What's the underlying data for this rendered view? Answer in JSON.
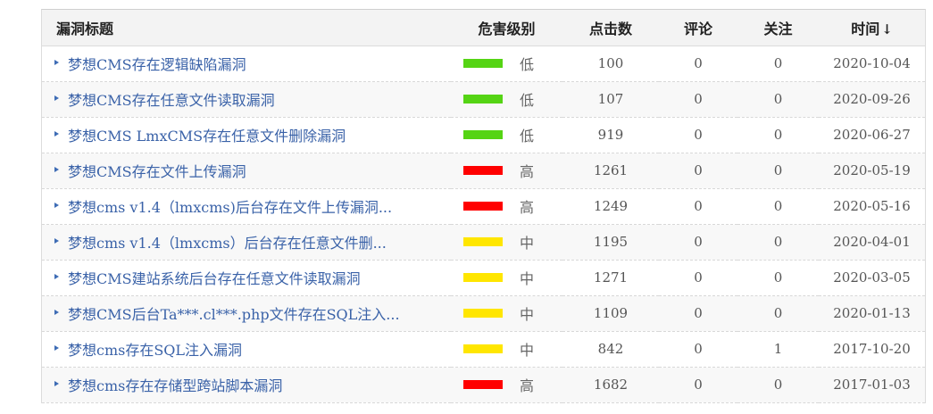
{
  "columns": {
    "title": "漏洞标题",
    "severity": "危害级别",
    "clicks": "点击数",
    "comments": "评论",
    "follows": "关注",
    "time": "时间",
    "time_sort": "↓"
  },
  "colors": {
    "low": "#55d414",
    "high": "#ff0000",
    "medium": "#ffe600"
  },
  "rows": [
    {
      "title": "梦想CMS存在逻辑缺陷漏洞",
      "level": "low",
      "severity": "低",
      "clicks": "100",
      "comments": "0",
      "follows": "0",
      "time": "2020-10-04"
    },
    {
      "title": "梦想CMS存在任意文件读取漏洞",
      "level": "low",
      "severity": "低",
      "clicks": "107",
      "comments": "0",
      "follows": "0",
      "time": "2020-09-26"
    },
    {
      "title": "梦想CMS LmxCMS存在任意文件删除漏洞",
      "level": "low",
      "severity": "低",
      "clicks": "919",
      "comments": "0",
      "follows": "0",
      "time": "2020-06-27"
    },
    {
      "title": "梦想CMS存在文件上传漏洞",
      "level": "high",
      "severity": "高",
      "clicks": "1261",
      "comments": "0",
      "follows": "0",
      "time": "2020-05-19"
    },
    {
      "title": "梦想cms v1.4（lmxcms)后台存在文件上传漏洞...",
      "level": "high",
      "severity": "高",
      "clicks": "1249",
      "comments": "0",
      "follows": "0",
      "time": "2020-05-16"
    },
    {
      "title": "梦想cms v1.4（lmxcms）后台存在任意文件删...",
      "level": "medium",
      "severity": "中",
      "clicks": "1195",
      "comments": "0",
      "follows": "0",
      "time": "2020-04-01"
    },
    {
      "title": "梦想CMS建站系统后台存在任意文件读取漏洞",
      "level": "medium",
      "severity": "中",
      "clicks": "1271",
      "comments": "0",
      "follows": "0",
      "time": "2020-03-05"
    },
    {
      "title": "梦想CMS后台Ta***.cl***.php文件存在SQL注入...",
      "level": "medium",
      "severity": "中",
      "clicks": "1109",
      "comments": "0",
      "follows": "0",
      "time": "2020-01-13"
    },
    {
      "title": "梦想cms存在SQL注入漏洞",
      "level": "medium",
      "severity": "中",
      "clicks": "842",
      "comments": "0",
      "follows": "1",
      "time": "2017-10-20"
    },
    {
      "title": "梦想cms存在存储型跨站脚本漏洞",
      "level": "high",
      "severity": "高",
      "clicks": "1682",
      "comments": "0",
      "follows": "0",
      "time": "2017-01-03"
    }
  ]
}
